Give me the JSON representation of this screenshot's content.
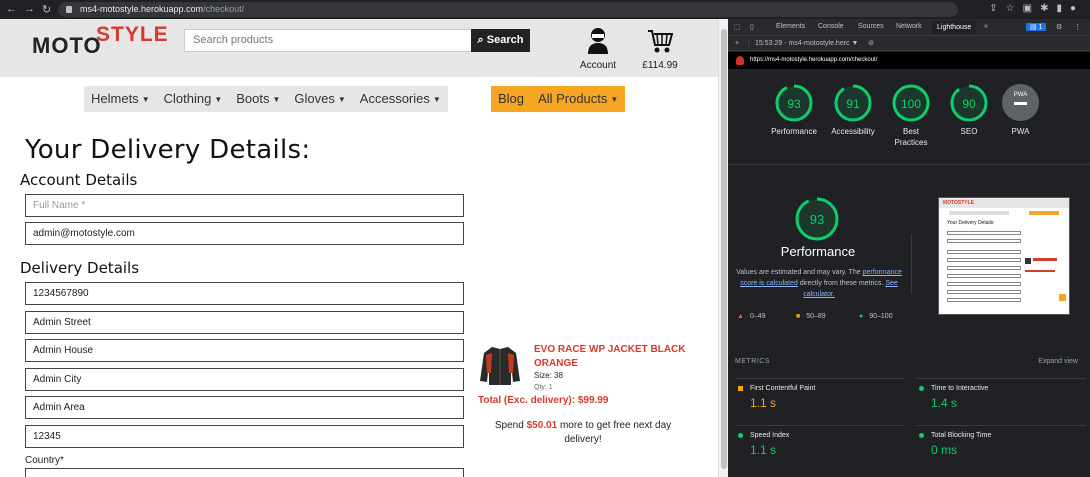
{
  "browser": {
    "url_domain": "ms4-motostyle.herokuapp.com",
    "url_path": "/checkout/",
    "nav_icons": [
      "back-icon",
      "forward-icon",
      "reload-icon",
      "lock-icon"
    ]
  },
  "header": {
    "logo_moto": "MOTO",
    "logo_style": "STYLE",
    "search_placeholder": "Search products",
    "search_button": "Search",
    "account_label": "Account",
    "bag_total": "£114.99"
  },
  "nav": {
    "items": [
      {
        "label": "Helmets",
        "caret": "▼"
      },
      {
        "label": "Clothing",
        "caret": "▼"
      },
      {
        "label": "Boots",
        "caret": "▼"
      },
      {
        "label": "Gloves",
        "caret": "▼"
      },
      {
        "label": "Accessories",
        "caret": "▼"
      }
    ],
    "blog": "Blog",
    "all_products": "All Products",
    "all_products_caret": "▼"
  },
  "form": {
    "title": "Your Delivery Details:",
    "account_heading": "Account Details",
    "full_name_placeholder": "Full Name *",
    "email_value": "admin@motostyle.com",
    "delivery_heading": "Delivery Details",
    "phone_value": "1234567890",
    "street1_value": "Admin Street",
    "street2_value": "Admin House",
    "city_value": "Admin City",
    "county_value": "Admin Area",
    "postcode_value": "12345",
    "country_label": "Country*"
  },
  "order": {
    "product_name": "EVO RACE WP JACKET BLACK ORANGE",
    "size": "Size: 38",
    "qty": "Qty: 1",
    "total": "Total (Exc. delivery): $99.99",
    "spend_prefix": "Spend",
    "spend_amount": "$50.01",
    "spend_suffix": "more to get free next day delivery!"
  },
  "devtools": {
    "tabs": [
      "Elements",
      "Console",
      "Sources",
      "Network",
      "Lighthouse",
      "»"
    ],
    "active_tab": "Lighthouse",
    "issues_badge": "1",
    "session": "15:53:29 - ms4-motostyle.herc ▼",
    "report_url": "https://ms4-motostyle.herokuapp.com/checkout/",
    "scores": [
      {
        "label": "Performance",
        "value": "93",
        "score": 0.93,
        "color": "#0cce6b"
      },
      {
        "label": "Accessibility",
        "value": "91",
        "score": 0.91,
        "color": "#0cce6b"
      },
      {
        "label": "Best Practices",
        "value": "100",
        "score": 1.0,
        "color": "#0cce6b"
      },
      {
        "label": "SEO",
        "value": "90",
        "score": 0.9,
        "color": "#0cce6b"
      }
    ],
    "pwa_label": "PWA",
    "pwa_badge": "PWA",
    "performance_big": {
      "value": "93",
      "score": 0.93
    },
    "performance_title": "Performance",
    "perf_desc_1": "Values are estimated and may vary. The",
    "perf_desc_link1": "performance score is calculated",
    "perf_desc_2": "directly from these metrics.",
    "perf_desc_link2": "See calculator.",
    "legend": [
      {
        "range": "0–49",
        "symbol": "▲",
        "color": "#ff4e42"
      },
      {
        "range": "50–89",
        "symbol": "■",
        "color": "#ffa400"
      },
      {
        "range": "90–100",
        "symbol": "●",
        "color": "#0cce6b"
      }
    ],
    "metrics_heading": "METRICS",
    "expand_view": "Expand view",
    "metrics": [
      {
        "name": "First Contentful Paint",
        "value": "1.1 s",
        "color": "#ffa400",
        "shape": "square"
      },
      {
        "name": "Time to Interactive",
        "value": "1.4 s",
        "color": "#0cce6b",
        "shape": "circle"
      },
      {
        "name": "Speed Index",
        "value": "1.1 s",
        "color": "#0cce6b",
        "shape": "circle"
      },
      {
        "name": "Total Blocking Time",
        "value": "0 ms",
        "color": "#0cce6b",
        "shape": "circle"
      }
    ]
  }
}
